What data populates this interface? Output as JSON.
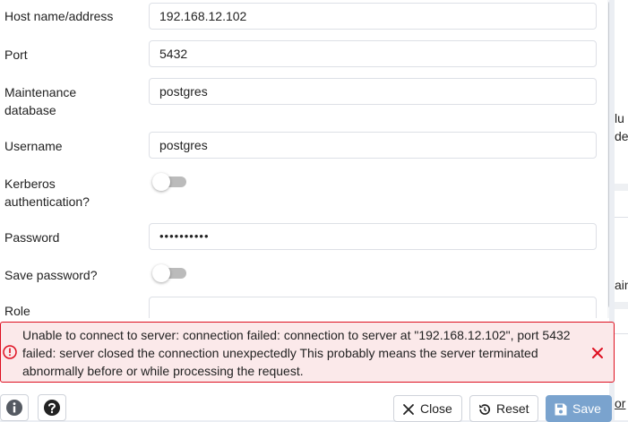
{
  "form": {
    "host": {
      "label": "Host name/address",
      "value": "192.168.12.102"
    },
    "port": {
      "label": "Port",
      "value": "5432"
    },
    "maintenance_db": {
      "label_line1": "Maintenance",
      "label_line2": "database",
      "value": "postgres"
    },
    "username": {
      "label": "Username",
      "value": "postgres"
    },
    "kerberos": {
      "label_line1": "Kerberos",
      "label_line2": "authentication?",
      "enabled": false
    },
    "password": {
      "label": "Password",
      "value": "••••••••••"
    },
    "save_password": {
      "label": "Save password?",
      "enabled": false
    },
    "role": {
      "label": "Role",
      "value": ""
    }
  },
  "error": {
    "message": "Unable to connect to server: connection failed: connection to server at \"192.168.12.102\", port 5432 failed: server closed the connection unexpectedly This probably means the server terminated abnormally before or while processing the request.",
    "color": "#de0f20",
    "background": "#fbe9ea"
  },
  "footer": {
    "info_icon": "info-icon",
    "help_icon": "help-icon",
    "close_label": "Close",
    "reset_label": "Reset",
    "save_label": "Save",
    "save_color": "#7aa3ce"
  },
  "background_fragments": {
    "f1": "lu",
    "f2": "de",
    "f3": "ain",
    "f4": "or"
  }
}
